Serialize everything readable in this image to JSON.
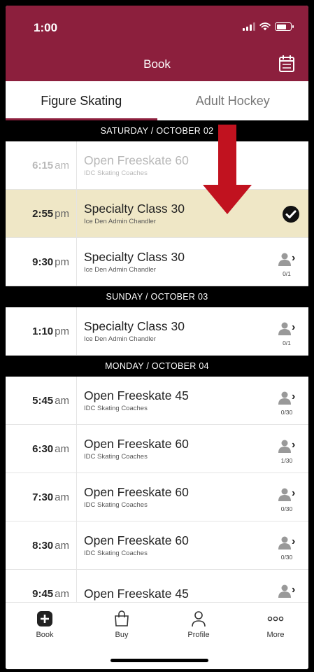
{
  "status_bar": {
    "time": "1:00"
  },
  "header": {
    "title": "Book",
    "calendar_icon": "calendar-icon"
  },
  "tabs": [
    {
      "label": "Figure Skating",
      "active": true
    },
    {
      "label": "Adult Hockey",
      "active": false
    }
  ],
  "days": [
    {
      "label": "SATURDAY / OCTOBER 02",
      "sessions": [
        {
          "time": "6:15",
          "ampm": "am",
          "title": "Open Freeskate 60",
          "coach": "IDC Skating Coaches",
          "faded": true,
          "selected": false,
          "count": ""
        },
        {
          "time": "2:55",
          "ampm": "pm",
          "title": "Specialty Class 30",
          "coach": "Ice Den Admin Chandler",
          "faded": false,
          "selected": true,
          "count": ""
        },
        {
          "time": "9:30",
          "ampm": "pm",
          "title": "Specialty Class 30",
          "coach": "Ice Den Admin Chandler",
          "faded": false,
          "selected": false,
          "count": "0/1"
        }
      ]
    },
    {
      "label": "SUNDAY / OCTOBER 03",
      "sessions": [
        {
          "time": "1:10",
          "ampm": "pm",
          "title": "Specialty Class 30",
          "coach": "Ice Den Admin Chandler",
          "faded": false,
          "selected": false,
          "count": "0/1"
        }
      ]
    },
    {
      "label": "MONDAY / OCTOBER 04",
      "sessions": [
        {
          "time": "5:45",
          "ampm": "am",
          "title": "Open Freeskate 45",
          "coach": "IDC Skating Coaches",
          "faded": false,
          "selected": false,
          "count": "0/30"
        },
        {
          "time": "6:30",
          "ampm": "am",
          "title": "Open Freeskate 60",
          "coach": "IDC Skating Coaches",
          "faded": false,
          "selected": false,
          "count": "1/30"
        },
        {
          "time": "7:30",
          "ampm": "am",
          "title": "Open Freeskate 60",
          "coach": "IDC Skating Coaches",
          "faded": false,
          "selected": false,
          "count": "0/30"
        },
        {
          "time": "8:30",
          "ampm": "am",
          "title": "Open Freeskate 60",
          "coach": "IDC Skating Coaches",
          "faded": false,
          "selected": false,
          "count": "0/30"
        },
        {
          "time": "9:45",
          "ampm": "am",
          "title": "Open Freeskate 45",
          "coach": "",
          "faded": false,
          "selected": false,
          "count": ""
        }
      ]
    }
  ],
  "bottom_nav": [
    {
      "label": "Book",
      "icon": "plus-square-icon"
    },
    {
      "label": "Buy",
      "icon": "shopping-bag-icon"
    },
    {
      "label": "Profile",
      "icon": "person-icon"
    },
    {
      "label": "More",
      "icon": "more-dots-icon"
    }
  ],
  "colors": {
    "brand": "#8c1f3d",
    "selected_row": "#efe7c6",
    "annotation_arrow": "#c1121f"
  }
}
